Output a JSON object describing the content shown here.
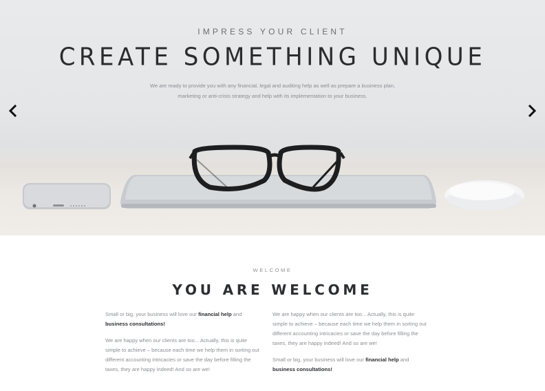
{
  "hero": {
    "subtitle": "IMPRESS YOUR CLIENT",
    "title": "CREATE SOMETHING UNIQUE",
    "lead_line1": "We are ready to provide you with any financial, legal and auditing help as well as prepare a business plan,",
    "lead_line2": "marketing or anti-crisis strategy and help with its implementation to your business.",
    "prev_icon": "chevron-left-icon",
    "next_icon": "chevron-right-icon"
  },
  "welcome": {
    "eyebrow": "WELCOME",
    "title": "YOU ARE WELCOME",
    "left": {
      "p1_text": "Small or big, your business will love our ",
      "p1_bold1": "financial help",
      "p1_mid": " and ",
      "p1_bold2": "business consultations!",
      "p2_text": "We are happy when our clients are too... Actually, this is quite simple to achieve – because each time we help them in sorting out different accounting intricacies or save the day before filling the taxes, they are happy indeed! And so are we!"
    },
    "right": {
      "p1_text": "We are happy when our clients are too... Actually, this is quite simple to achieve – because each time we help them in sorting out different accounting intricacies or save the day before filling the taxes, they are happy indeed! And so are we!",
      "p2_text": "Small or big, your business will love our ",
      "p2_bold1": "financial help",
      "p2_mid": " and ",
      "p2_bold2": "business consultations!"
    }
  }
}
